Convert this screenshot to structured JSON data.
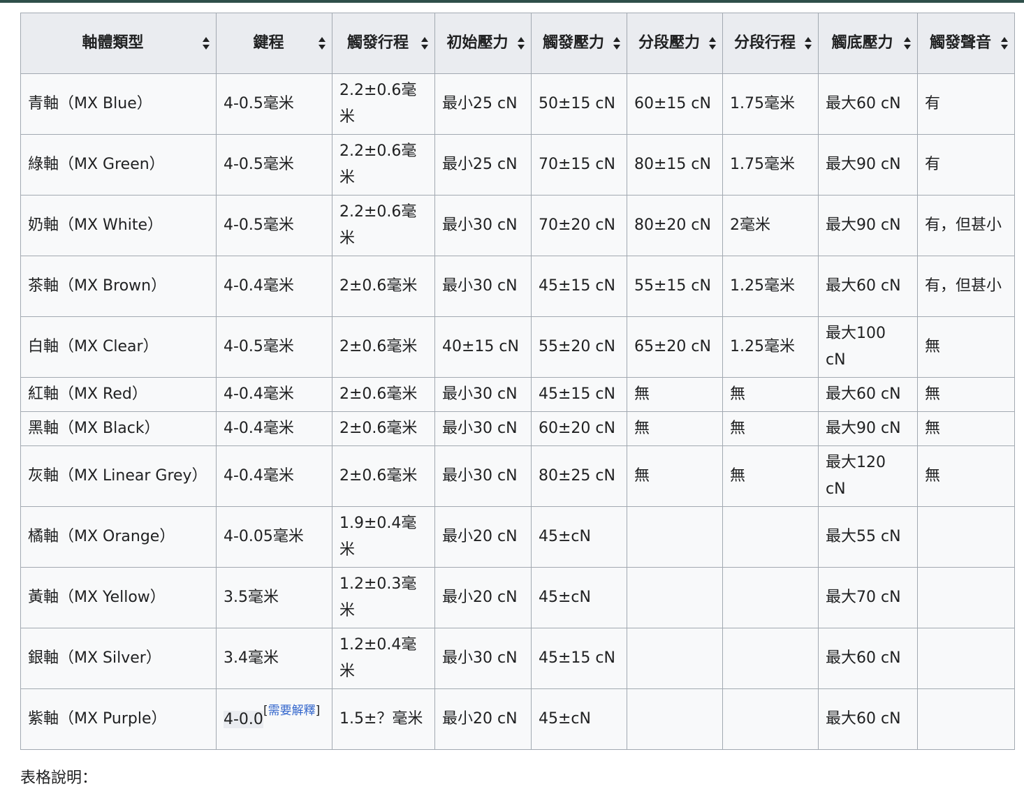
{
  "table": {
    "headers": [
      "軸體類型",
      "鍵程",
      "觸發行程",
      "初始壓力",
      "觸發壓力",
      "分段壓力",
      "分段行程",
      "觸底壓力",
      "觸發聲音"
    ],
    "rows": [
      [
        "青軸（MX Blue）",
        "4-0.5毫米",
        "2.2±0.6毫米",
        "最小25 cN",
        "50±15 cN",
        "60±15 cN",
        "1.75毫米",
        "最大60 cN",
        "有"
      ],
      [
        "綠軸（MX Green）",
        "4-0.5毫米",
        "2.2±0.6毫米",
        "最小25 cN",
        "70±15 cN",
        "80±15 cN",
        "1.75毫米",
        "最大90 cN",
        "有"
      ],
      [
        "奶軸（MX White）",
        "4-0.5毫米",
        "2.2±0.6毫米",
        "最小30 cN",
        "70±20 cN",
        "80±20 cN",
        "2毫米",
        "最大90 cN",
        "有，但甚小"
      ],
      [
        "茶軸（MX Brown）",
        "4-0.4毫米",
        "2±0.6毫米",
        "最小30 cN",
        "45±15 cN",
        "55±15 cN",
        "1.25毫米",
        "最大60 cN",
        "有，但甚小"
      ],
      [
        "白軸（MX Clear）",
        "4-0.5毫米",
        "2±0.6毫米",
        "40±15 cN",
        "55±20 cN",
        "65±20 cN",
        "1.25毫米",
        "最大100 cN",
        "無"
      ],
      [
        "紅軸（MX Red）",
        "4-0.4毫米",
        "2±0.6毫米",
        "最小30 cN",
        "45±15 cN",
        "無",
        "無",
        "最大60 cN",
        "無"
      ],
      [
        "黑軸（MX Black）",
        "4-0.4毫米",
        "2±0.6毫米",
        "最小30 cN",
        "60±20 cN",
        "無",
        "無",
        "最大90 cN",
        "無"
      ],
      [
        "灰軸（MX Linear Grey）",
        "4-0.4毫米",
        "2±0.6毫米",
        "最小30 cN",
        "80±25 cN",
        "無",
        "無",
        "最大120 cN",
        "無"
      ],
      [
        "橘軸（MX Orange）",
        "4-0.05毫米",
        "1.9±0.4毫米",
        "最小20 cN",
        "45±cN",
        "",
        "",
        "最大55 cN",
        ""
      ],
      [
        "黃軸（MX Yellow）",
        "3.5毫米",
        "1.2±0.3毫米",
        "最小20 cN",
        "45±cN",
        "",
        "",
        "最大70 cN",
        ""
      ],
      [
        "銀軸（MX Silver）",
        "3.4毫米",
        "1.2±0.4毫米",
        "最小30 cN",
        "45±15 cN",
        "",
        "",
        "最大60 cN",
        ""
      ],
      [
        "紫軸（MX Purple）",
        "4-0.0",
        "1.5±？毫米",
        "最小20 cN",
        "45±cN",
        "",
        "",
        "最大60 cN",
        ""
      ]
    ],
    "citation_needed": "需要解釋"
  },
  "footer_text": "表格說明："
}
